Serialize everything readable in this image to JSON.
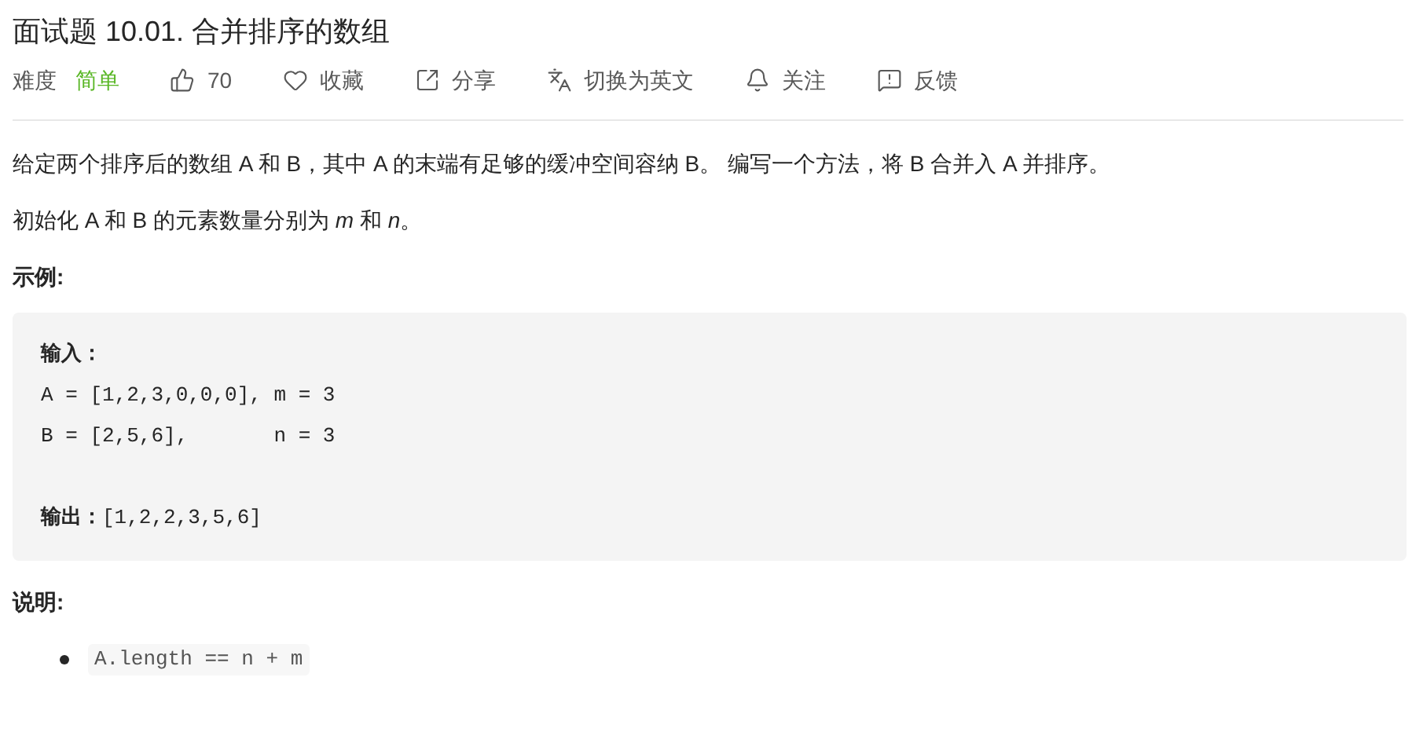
{
  "title": "面试题 10.01. 合并排序的数组",
  "meta": {
    "difficulty_label": "难度",
    "difficulty": "简单",
    "actions": [
      {
        "kind": "like",
        "label": "70"
      },
      {
        "kind": "favorite",
        "label": "收藏"
      },
      {
        "kind": "share",
        "label": "分享"
      },
      {
        "kind": "translate",
        "label": "切换为英文"
      },
      {
        "kind": "follow",
        "label": "关注"
      },
      {
        "kind": "feedback",
        "label": "反馈"
      }
    ]
  },
  "description": [
    "给定两个排序后的数组 A 和 B，其中 A 的末端有足够的缓冲空间容纳 B。 编写一个方法，将 B 合并入 A 并排序。",
    "初始化 A 和 B 的元素数量分别为 *m* 和 *n*。"
  ],
  "example_heading": "示例:",
  "example": {
    "input_label": "输入：",
    "lines": [
      "A = [1,2,3,0,0,0], m = 3",
      "B = [2,5,6],       n = 3"
    ],
    "output": "**输出：**[1,2,2,3,5,6]"
  },
  "notes_heading": "说明:",
  "notes": [
    "A.length == n + m"
  ]
}
